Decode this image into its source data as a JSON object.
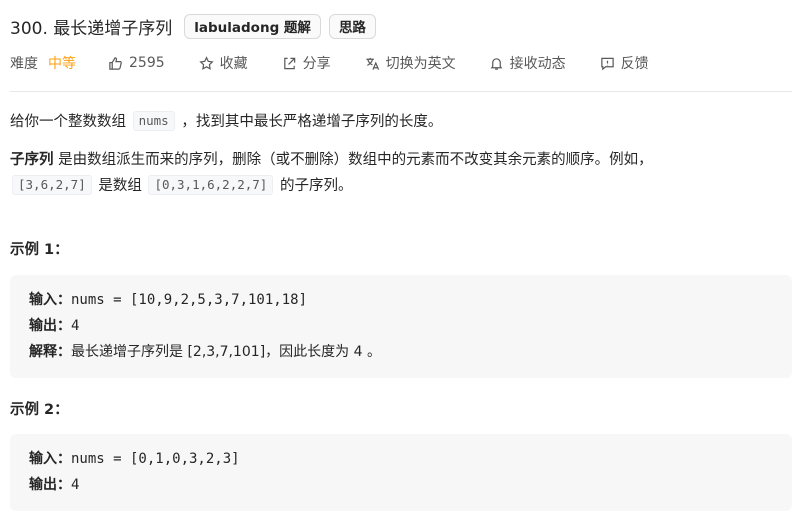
{
  "header": {
    "title": "300. 最长递增子序列",
    "tags": [
      "labuladong 题解",
      "思路"
    ]
  },
  "meta": {
    "difficulty_label": "难度",
    "difficulty_value": "中等",
    "likes": "2595",
    "collect": "收藏",
    "share": "分享",
    "translate": "切换为英文",
    "follow": "接收动态",
    "feedback": "反馈"
  },
  "description": {
    "p1_before": "给你一个整数数组",
    "p1_code": "nums",
    "p1_after": "，找到其中最长严格递增子序列的长度。",
    "p2_bold": "子序列",
    "p2_text": "是由数组派生而来的序列，删除（或不删除）数组中的元素而不改变其余元素的顺序。例如，",
    "p3_code1": "[3,6,2,7]",
    "p3_mid": "是数组",
    "p3_code2": "[0,3,1,6,2,2,7]",
    "p3_after": "的子序列。"
  },
  "examples": [
    {
      "title": "示例 1：",
      "input_label": "输入：",
      "input_value": "nums = [10,9,2,5,3,7,101,18]",
      "output_label": "输出：",
      "output_value": "4",
      "explain_label": "解释：",
      "explain_text": "最长递增子序列是 [2,3,7,101]，因此长度为 4 。"
    },
    {
      "title": "示例 2：",
      "input_label": "输入：",
      "input_value": "nums = [0,1,0,3,2,3]",
      "output_label": "输出：",
      "output_value": "4"
    }
  ],
  "colors": {
    "difficulty_medium": "#ffa116",
    "code_bg": "#f7f7f8"
  },
  "icons": [
    "thumbs-up-icon",
    "star-icon",
    "share-icon",
    "translate-icon",
    "bell-icon",
    "feedback-icon"
  ]
}
